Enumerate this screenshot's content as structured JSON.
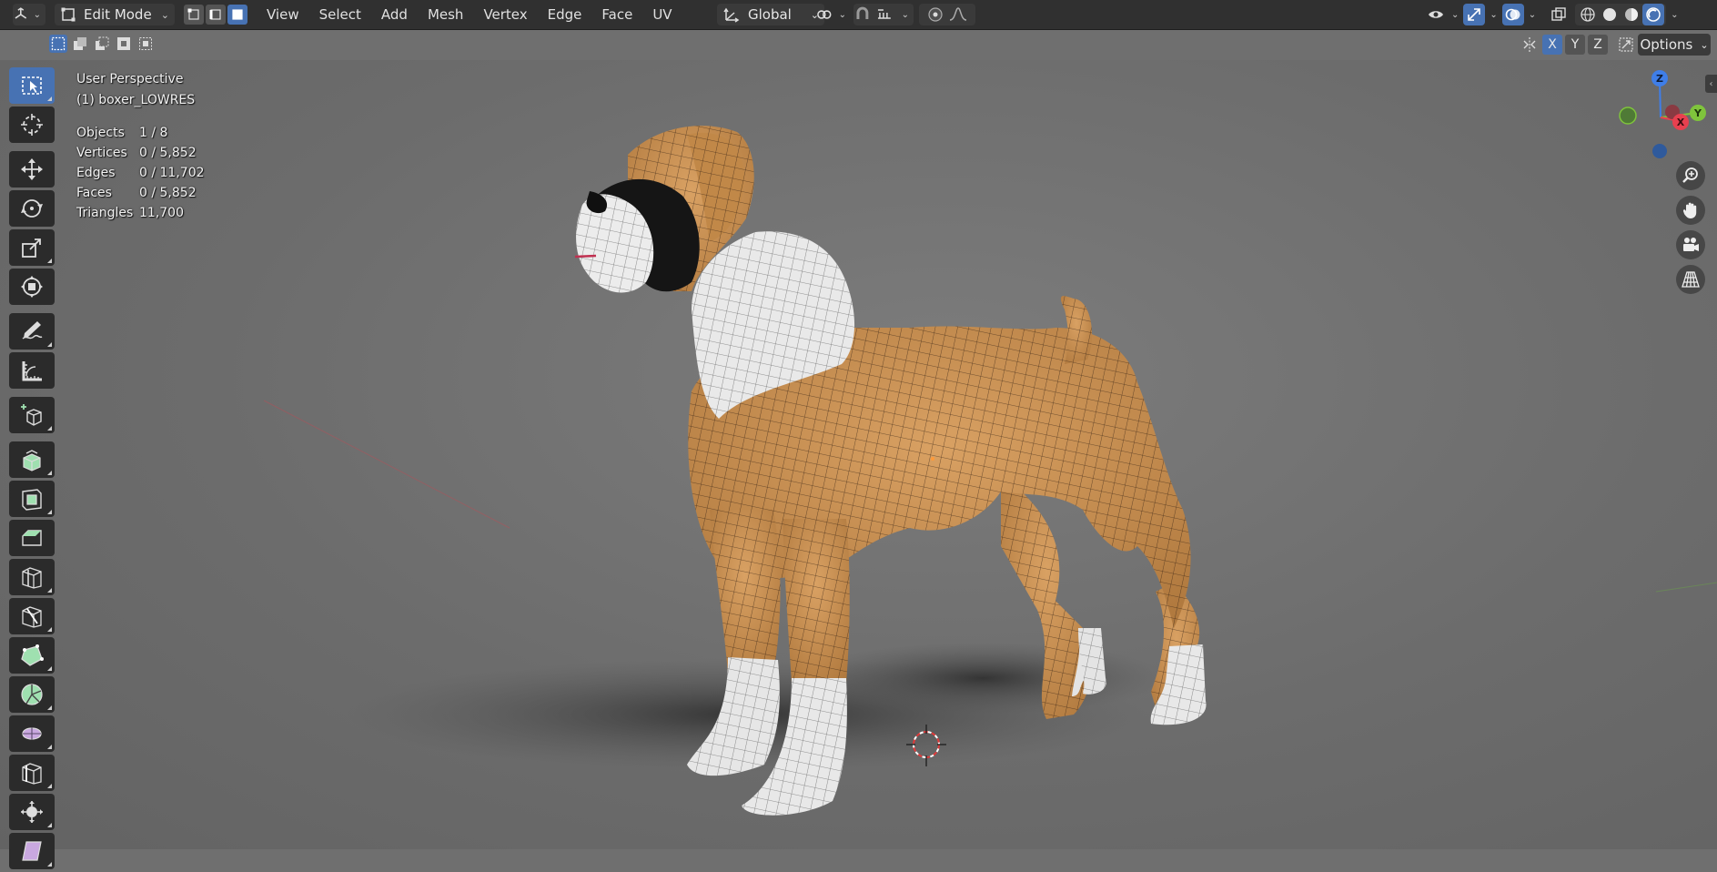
{
  "header": {
    "mode": "Edit Mode",
    "menus": [
      "View",
      "Select",
      "Add",
      "Mesh",
      "Vertex",
      "Edge",
      "Face",
      "UV"
    ],
    "orientation": "Global"
  },
  "tool_header": {
    "mirror_axes": [
      "X",
      "Y",
      "Z"
    ],
    "options_label": "Options"
  },
  "viewport": {
    "view_name": "User Perspective",
    "object_name": "(1) boxer_LOWRES",
    "stats": [
      {
        "label": "Objects",
        "value": "1 / 8"
      },
      {
        "label": "Vertices",
        "value": "0 / 5,852"
      },
      {
        "label": "Edges",
        "value": "0 / 11,702"
      },
      {
        "label": "Faces",
        "value": "0 / 5,852"
      },
      {
        "label": "Triangles",
        "value": "11,700"
      }
    ],
    "gizmo_axes": {
      "z": "Z",
      "x": "X",
      "y": "Y"
    }
  },
  "colors": {
    "accent": "#4772b3",
    "header": "#303030",
    "viewport_bg": "#6f6f6f",
    "axis_x": "#e8404f",
    "axis_y": "#7fc43c",
    "axis_z": "#3f7ee8"
  },
  "toolbar_tools": [
    "select-box",
    "cursor",
    "move",
    "rotate",
    "scale",
    "transform",
    "annotate",
    "measure",
    "add-cube",
    "extrude",
    "inset",
    "bevel",
    "loop-cut",
    "knife",
    "poly-build",
    "spin",
    "smooth",
    "edge-slide",
    "shrink-fatten",
    "shear"
  ]
}
